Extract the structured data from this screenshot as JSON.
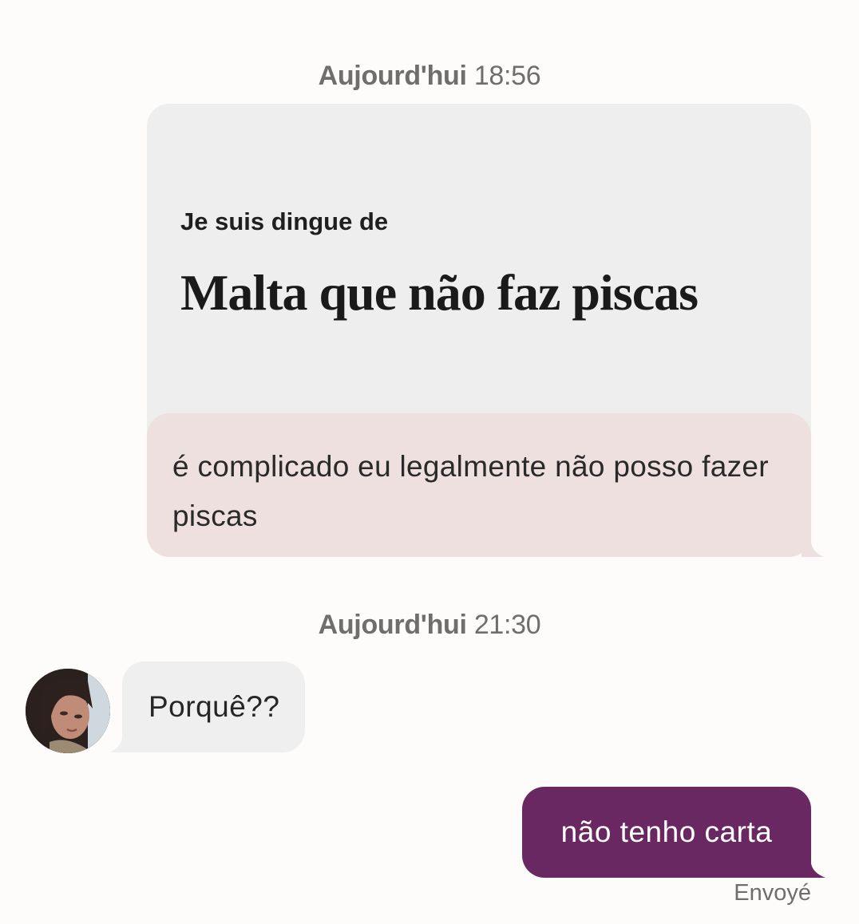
{
  "colors": {
    "background": "#fdfcfb",
    "prompt_card": "#eeeeef",
    "reply_box": "#eee0de",
    "incoming_bubble": "#efefef",
    "outgoing_bubble": "#6a2862",
    "timestamp_text": "#6e6e6e"
  },
  "conversation": {
    "separators": [
      {
        "day": "Aujourd'hui",
        "time": "18:56"
      },
      {
        "day": "Aujourd'hui",
        "time": "21:30"
      }
    ],
    "prompt_card": {
      "question": "Je suis dingue de",
      "answer": "Malta que não faz piscas",
      "reply": "é complicado eu legalmente não posso fazer piscas"
    },
    "incoming_message": {
      "avatar_icon": "user-photo",
      "text": "Porquê??"
    },
    "outgoing_message": {
      "text": "não tenho carta",
      "status": "Envoyé"
    }
  }
}
